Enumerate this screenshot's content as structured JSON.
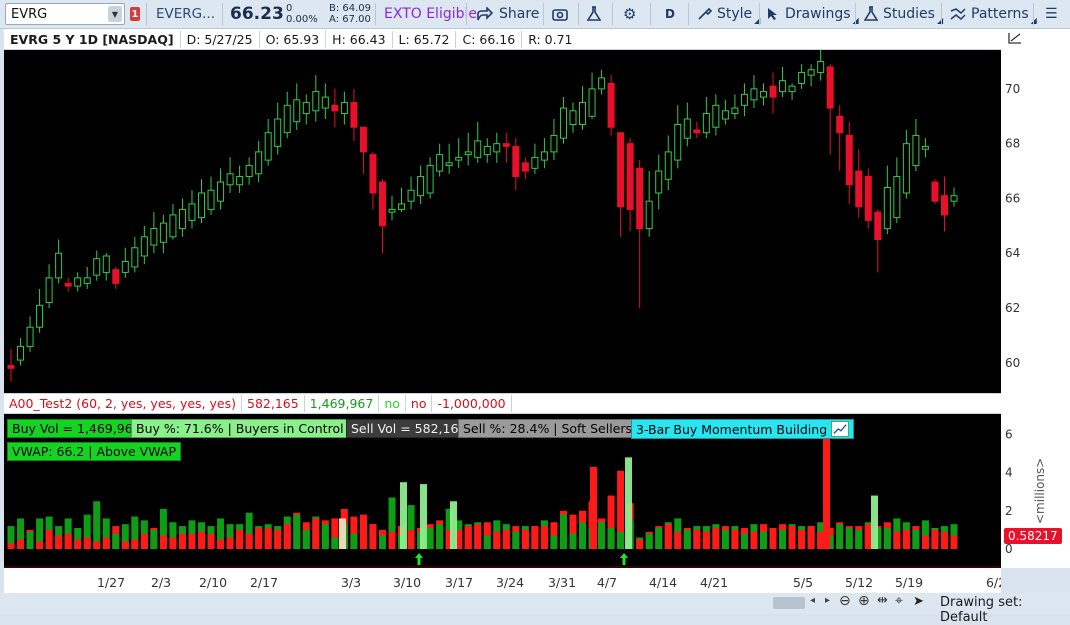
{
  "toolbar": {
    "symbol": "EVRG",
    "alert_count": "1",
    "company_short": "EVERG...",
    "last_price": "66.23",
    "change_line1": "0",
    "change_line2": "0.00%",
    "bid": "B: 64.09",
    "ask": "A: 67.00",
    "exto": "EXTO Eligible",
    "share": "Share",
    "aggregation": "D",
    "style": "Style",
    "drawings": "Drawings",
    "studies": "Studies",
    "patterns": "Patterns"
  },
  "quote": {
    "title": "EVRG 5 Y 1D [NASDAQ]",
    "date": "D: 5/27/25",
    "open": "O: 65.93",
    "high": "H: 66.43",
    "low": "L: 65.72",
    "close": "C: 66.16",
    "range": "R: 0.71"
  },
  "study_header": {
    "name": "A00_Test2 (60, 2, yes, yes, yes, yes)",
    "sell_vol": "582,165",
    "buy_vol": "1,469,967",
    "flag1": "no",
    "flag2": "no",
    "value": "-1,000,000"
  },
  "labels": {
    "buy_vol": "Buy Vol = 1,469,967",
    "buy_pct": "Buy %: 71.6% | Buyers in Control",
    "sell_vol": "Sell Vol = 582,165",
    "sell_pct": "Sell %: 28.4% | Soft Sellers",
    "momentum": "3-Bar Buy Momentum Building",
    "vwap": "VWAP: 66.2 | Above VWAP"
  },
  "axis": {
    "price_ticks": [
      "70",
      "68",
      "66",
      "64",
      "62",
      "60"
    ],
    "volume_ticks": [
      "6",
      "4",
      "2",
      "0"
    ],
    "volume_unit": "<millions>",
    "volume_marker": "0.58217",
    "date_ticks": [
      "1/27",
      "2/3",
      "2/10",
      "2/17",
      "3/3",
      "3/10",
      "3/17",
      "3/24",
      "3/31",
      "4/7",
      "4/14",
      "4/21",
      "5/5",
      "5/12",
      "5/19",
      "6/2"
    ]
  },
  "status": {
    "drawing_set": "Drawing set: Default"
  },
  "colors": {
    "up": "#35c94a",
    "down": "#e8102a",
    "buy": "#0f9d16",
    "sell": "#ff1a1a",
    "momentum": "#27e6f2"
  },
  "chart_data": [
    {
      "type": "candlestick",
      "title": "EVRG 5 Y 1D [NASDAQ]",
      "ylim": [
        59.3,
        71.2
      ],
      "ohlc": [
        [
          59.9,
          59.8,
          60.5,
          59.3
        ],
        [
          60.1,
          60.6,
          60.9,
          59.9
        ],
        [
          60.6,
          61.3,
          61.7,
          60.4
        ],
        [
          61.3,
          62.1,
          62.7,
          61.1
        ],
        [
          62.2,
          63.1,
          63.6,
          62.0
        ],
        [
          63.1,
          64.0,
          64.5,
          62.9
        ],
        [
          62.9,
          62.8,
          63.1,
          62.6
        ],
        [
          62.8,
          63.1,
          63.3,
          62.6
        ],
        [
          62.9,
          63.1,
          63.5,
          62.7
        ],
        [
          63.2,
          63.8,
          64.1,
          63.0
        ],
        [
          63.3,
          63.9,
          64.0,
          63.0
        ],
        [
          63.4,
          62.9,
          63.5,
          62.7
        ],
        [
          63.3,
          63.7,
          64.2,
          63.1
        ],
        [
          63.5,
          64.2,
          64.6,
          63.3
        ],
        [
          63.9,
          64.6,
          65.0,
          63.6
        ],
        [
          64.3,
          64.9,
          65.5,
          64.0
        ],
        [
          64.4,
          65.1,
          65.4,
          64.0
        ],
        [
          64.6,
          65.4,
          65.8,
          64.5
        ],
        [
          64.9,
          65.6,
          66.0,
          64.6
        ],
        [
          65.2,
          65.8,
          66.3,
          64.9
        ],
        [
          65.3,
          66.2,
          66.7,
          65.1
        ],
        [
          65.6,
          66.3,
          66.8,
          65.4
        ],
        [
          65.9,
          66.6,
          67.1,
          65.6
        ],
        [
          66.5,
          66.9,
          67.5,
          66.2
        ],
        [
          66.5,
          66.8,
          67.2,
          66.2
        ],
        [
          66.8,
          67.2,
          67.5,
          66.5
        ],
        [
          66.9,
          67.7,
          68.1,
          66.6
        ],
        [
          67.4,
          68.4,
          68.9,
          67.2
        ],
        [
          67.9,
          68.9,
          69.5,
          67.6
        ],
        [
          68.4,
          69.4,
          69.9,
          68.2
        ],
        [
          68.8,
          69.6,
          70.2,
          68.5
        ],
        [
          69.1,
          69.5,
          69.8,
          68.7
        ],
        [
          69.2,
          69.9,
          70.5,
          68.8
        ],
        [
          69.3,
          69.7,
          70.2,
          68.9
        ],
        [
          69.4,
          69.2,
          70.0,
          68.6
        ],
        [
          69.1,
          69.5,
          69.9,
          68.7
        ],
        [
          69.5,
          68.6,
          70.0,
          68.1
        ],
        [
          68.6,
          67.7,
          68.5,
          66.9
        ],
        [
          67.6,
          66.2,
          67.7,
          65.6
        ],
        [
          66.6,
          65.0,
          66.7,
          64.0
        ],
        [
          65.5,
          65.6,
          66.1,
          65.2
        ],
        [
          65.6,
          65.8,
          66.4,
          65.5
        ],
        [
          65.9,
          66.3,
          66.8,
          65.6
        ],
        [
          66.1,
          66.8,
          67.2,
          65.8
        ],
        [
          66.2,
          67.2,
          67.5,
          66.0
        ],
        [
          67.0,
          67.6,
          68.0,
          66.8
        ],
        [
          67.2,
          67.3,
          68.0,
          66.9
        ],
        [
          67.4,
          67.5,
          68.2,
          67.1
        ],
        [
          67.6,
          67.7,
          68.4,
          67.2
        ],
        [
          67.5,
          68.1,
          68.8,
          67.3
        ],
        [
          67.6,
          67.9,
          68.2,
          67.3
        ],
        [
          67.7,
          68.0,
          68.4,
          67.3
        ],
        [
          68.0,
          67.9,
          68.4,
          67.3
        ],
        [
          67.9,
          66.8,
          68.2,
          66.3
        ],
        [
          67.3,
          67.0,
          67.5,
          66.7
        ],
        [
          67.1,
          67.5,
          68.0,
          66.9
        ],
        [
          67.4,
          67.7,
          68.2,
          67.1
        ],
        [
          67.7,
          68.3,
          68.9,
          67.4
        ],
        [
          68.2,
          69.3,
          69.7,
          68.0
        ],
        [
          68.7,
          69.2,
          69.5,
          68.4
        ],
        [
          68.7,
          69.5,
          70.1,
          68.5
        ],
        [
          69.0,
          70.0,
          70.6,
          68.9
        ],
        [
          70.0,
          70.4,
          70.7,
          69.8
        ],
        [
          70.2,
          68.6,
          70.5,
          68.3
        ],
        [
          68.4,
          65.7,
          68.4,
          64.6
        ],
        [
          68.0,
          65.6,
          68.2,
          64.8
        ],
        [
          67.1,
          64.9,
          67.4,
          62.0
        ],
        [
          64.9,
          65.9,
          67.0,
          64.6
        ],
        [
          66.2,
          67.0,
          67.6,
          65.6
        ],
        [
          66.7,
          67.7,
          68.3,
          66.3
        ],
        [
          67.4,
          68.7,
          69.4,
          67.1
        ],
        [
          68.2,
          68.9,
          69.5,
          67.9
        ],
        [
          68.5,
          68.4,
          68.8,
          68.2
        ],
        [
          68.4,
          69.1,
          69.7,
          68.2
        ],
        [
          68.6,
          69.4,
          69.8,
          68.3
        ],
        [
          68.9,
          69.2,
          69.6,
          68.7
        ],
        [
          69.1,
          69.3,
          69.8,
          68.9
        ],
        [
          69.4,
          69.8,
          70.2,
          69.0
        ],
        [
          69.6,
          70.0,
          70.5,
          69.3
        ],
        [
          69.7,
          69.9,
          70.2,
          69.4
        ],
        [
          70.1,
          69.7,
          70.6,
          69.1
        ],
        [
          69.9,
          70.3,
          70.8,
          69.7
        ],
        [
          69.9,
          70.1,
          70.2,
          69.6
        ],
        [
          70.2,
          70.6,
          70.9,
          70.0
        ],
        [
          70.5,
          70.7,
          70.9,
          70.1
        ],
        [
          70.6,
          71.0,
          71.5,
          70.3
        ],
        [
          70.8,
          69.3,
          70.9,
          67.6
        ],
        [
          69.0,
          68.4,
          69.4,
          67.0
        ],
        [
          68.3,
          66.5,
          68.8,
          65.8
        ],
        [
          67.0,
          65.7,
          67.8,
          65.3
        ],
        [
          66.8,
          65.2,
          67.1,
          64.9
        ],
        [
          65.5,
          64.5,
          65.6,
          63.3
        ],
        [
          64.9,
          66.4,
          67.2,
          64.7
        ],
        [
          65.3,
          66.8,
          67.5,
          65.1
        ],
        [
          66.2,
          68.0,
          68.5,
          66.0
        ],
        [
          67.2,
          68.3,
          68.9,
          67.0
        ],
        [
          67.8,
          67.9,
          68.2,
          67.5
        ],
        [
          66.6,
          65.9,
          66.7,
          65.8
        ],
        [
          66.1,
          65.4,
          66.8,
          64.8
        ],
        [
          65.9,
          66.1,
          66.4,
          65.7
        ]
      ]
    },
    {
      "type": "bar",
      "title": "A00_Test2 (60, 2, yes, yes, yes, yes)",
      "ylabel": "<millions>",
      "ylim": [
        0,
        6.6
      ],
      "buy": [
        1.2,
        1.6,
        0.9,
        1.6,
        1.7,
        1.2,
        1.6,
        1.1,
        1.8,
        2.5,
        1.6,
        0.8,
        1.3,
        1.7,
        1.5,
        1.0,
        2.1,
        1.4,
        1.2,
        1.5,
        1.4,
        1.2,
        1.6,
        1.3,
        1.3,
        1.9,
        1.2,
        1.3,
        1.2,
        1.7,
        1.8,
        1.0,
        1.7,
        1.3,
        0.6,
        1.3,
        0.8,
        1.8,
        1.3,
        0.7,
        2.7,
        0.7,
        2.3,
        0.9,
        1.1,
        1.3,
        2.1,
        1.5,
        1.3,
        1.4,
        0.7,
        1.5,
        1.3,
        0.9,
        1.2,
        1.2,
        1.5,
        0.7,
        1.8,
        0.8,
        1.4,
        1.1,
        1.4,
        1.1,
        0.9,
        1.5,
        0.6,
        0.8,
        1.1,
        1.4,
        1.6,
        1.0,
        1.2,
        1.2,
        1.3,
        1.0,
        1.2,
        0.8,
        1.3,
        0.9,
        1.1,
        1.0,
        1.3,
        1.2,
        1.2,
        1.4,
        0.7,
        1.3,
        1.1,
        1.0,
        1.4,
        1.1,
        1.1,
        1.6,
        1.4,
        1.0,
        1.5,
        1.1,
        1.2,
        1.3
      ],
      "sell": [
        0.3,
        0.5,
        1.0,
        0.4,
        1.0,
        0.7,
        0.8,
        0.5,
        0.6,
        0.4,
        0.6,
        1.2,
        0.4,
        0.5,
        0.8,
        1.1,
        0.7,
        0.6,
        0.8,
        0.8,
        0.9,
        0.8,
        0.5,
        0.6,
        1.0,
        0.8,
        1.1,
        1.1,
        1.0,
        1.3,
        1.9,
        1.4,
        1.6,
        1.5,
        1.6,
        2.1,
        1.7,
        1.8,
        1.3,
        1.0,
        0.9,
        1.2,
        1.0,
        1.1,
        1.3,
        1.5,
        1.0,
        1.0,
        1.2,
        1.3,
        1.4,
        0.9,
        1.0,
        1.2,
        1.0,
        1.2,
        1.2,
        1.4,
        2.0,
        1.8,
        2.0,
        2.5,
        1.6,
        2.8,
        4.1,
        2.4,
        0.5,
        0.9,
        1.2,
        1.3,
        0.9,
        1.1,
        1.0,
        0.9,
        1.1,
        1.2,
        1.0,
        1.1,
        0.9,
        1.3,
        1.1,
        1.3,
        1.2,
        1.0,
        1.2,
        0.9,
        1.1,
        1.4,
        1.2,
        1.2,
        1.3,
        1.2,
        1.4,
        0.9,
        1.0,
        1.2,
        0.7,
        1.0,
        0.9,
        0.7
      ]
    }
  ]
}
